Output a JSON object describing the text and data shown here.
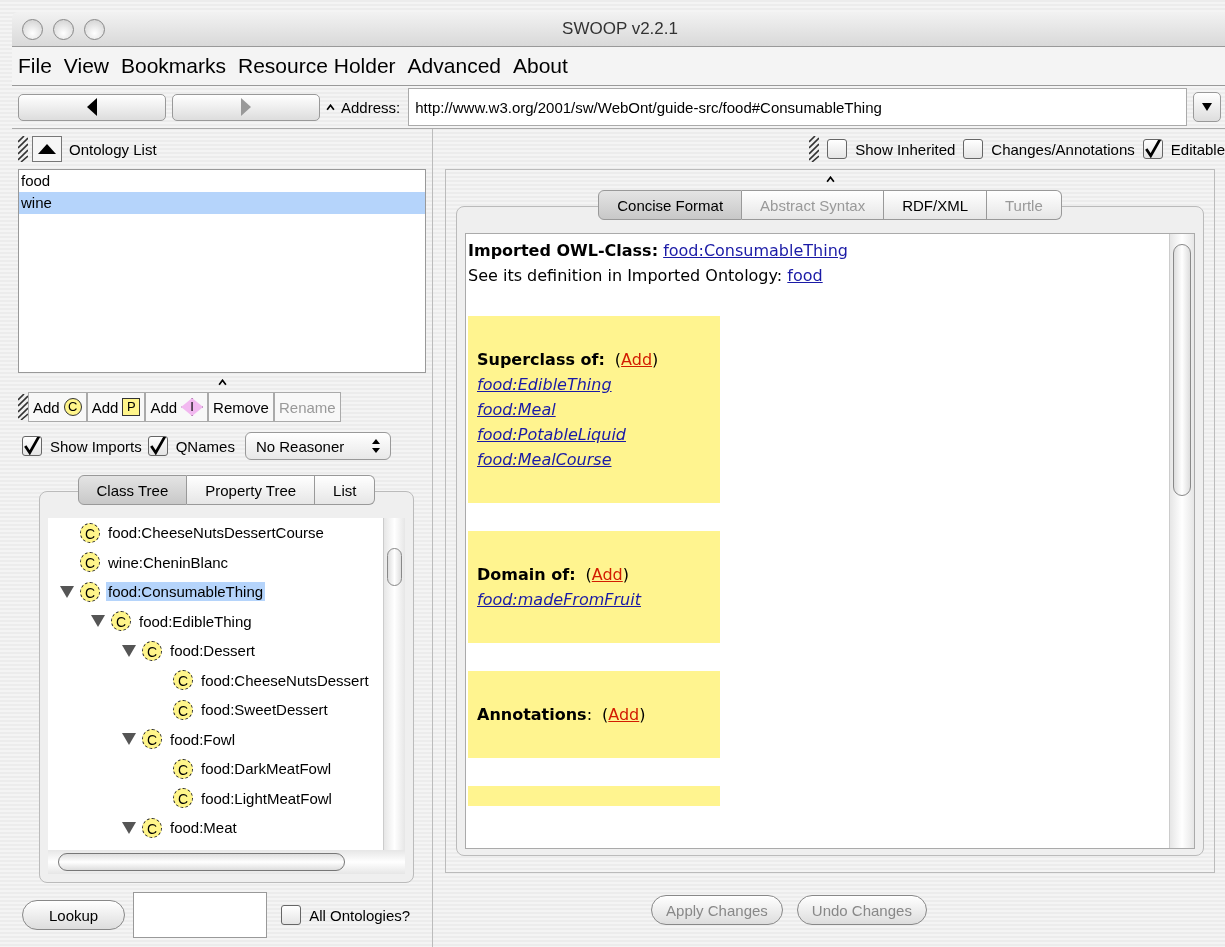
{
  "window": {
    "title": "SWOOP v2.2.1"
  },
  "menu": [
    "File",
    "View",
    "Bookmarks",
    "Resource Holder",
    "Advanced",
    "About"
  ],
  "nav": [
    {
      "kind": "back",
      "disabled": false
    },
    {
      "kind": "forward",
      "disabled": true
    }
  ],
  "address": {
    "label": "Address:",
    "value": "http://www.w3.org/2001/sw/WebOnt/guide-src/food#ConsumableThing"
  },
  "ontology_list": {
    "title": "Ontology List",
    "items": [
      {
        "label": "food",
        "selected": false
      },
      {
        "label": "wine",
        "selected": true
      }
    ]
  },
  "actions": [
    {
      "label": "Add",
      "badge": "C",
      "kind": "class",
      "disabled": false
    },
    {
      "label": "Add",
      "badge": "P",
      "kind": "property",
      "disabled": false
    },
    {
      "label": "Add",
      "badge": "I",
      "kind": "individual",
      "disabled": false
    },
    {
      "label": "Remove",
      "disabled": false
    },
    {
      "label": "Rename",
      "disabled": true
    }
  ],
  "options": [
    {
      "label": "Show Imports",
      "checked": true
    },
    {
      "label": "QNames",
      "checked": true
    }
  ],
  "reasoner": {
    "value": "No Reasoner"
  },
  "tree_tabs": [
    {
      "label": "Class Tree",
      "selected": true
    },
    {
      "label": "Property Tree",
      "selected": false
    },
    {
      "label": "List",
      "selected": false
    }
  ],
  "tree": [
    {
      "label": "food:CheeseNutsDessertCourse",
      "badge": "C",
      "selected": false
    },
    {
      "label": "wine:CheninBlanc",
      "badge": "C",
      "selected": false
    },
    {
      "label": "food:ConsumableThing",
      "badge": "C",
      "selected": true,
      "expanded": true,
      "children": [
        {
          "label": "food:EdibleThing",
          "badge": "C",
          "selected": false,
          "expanded": true,
          "children": [
            {
              "label": "food:Dessert",
              "badge": "C",
              "selected": false,
              "expanded": true,
              "children": [
                {
                  "label": "food:CheeseNutsDessert",
                  "badge": "C",
                  "selected": false
                },
                {
                  "label": "food:SweetDessert",
                  "badge": "C",
                  "selected": false
                }
              ]
            },
            {
              "label": "food:Fowl",
              "badge": "C",
              "selected": false,
              "expanded": true,
              "children": [
                {
                  "label": "food:DarkMeatFowl",
                  "badge": "C",
                  "selected": false
                },
                {
                  "label": "food:LightMeatFowl",
                  "badge": "C",
                  "selected": false
                }
              ]
            },
            {
              "label": "food:Meat",
              "badge": "C",
              "selected": false,
              "expanded": true
            }
          ]
        }
      ]
    }
  ],
  "lookup": {
    "button": "Lookup",
    "option": {
      "label": "All Ontologies?",
      "checked": false
    }
  },
  "view_options": [
    {
      "label": "Show Inherited",
      "checked": false
    },
    {
      "label": "Changes/Annotations",
      "checked": false
    },
    {
      "label": "Editable",
      "checked": true
    }
  ],
  "format_tabs": [
    {
      "label": "Concise Format",
      "selected": true,
      "disabled": false
    },
    {
      "label": "Abstract Syntax",
      "selected": false,
      "disabled": true
    },
    {
      "label": "RDF/XML",
      "selected": false,
      "disabled": false
    },
    {
      "label": "Turtle",
      "selected": false,
      "disabled": true
    }
  ],
  "content": {
    "heading": {
      "label": "Imported OWL-Class:",
      "link": "food:ConsumableThing"
    },
    "note": {
      "text": "See its definition in Imported Ontology:",
      "link": "food"
    },
    "sections": [
      {
        "kind": "section",
        "title": "Superclass of:",
        "open": "(",
        "add": "Add",
        "close": ")",
        "items": [
          "food:EdibleThing",
          "food:Meal",
          "food:PotableLiquid",
          "food:MealCourse"
        ]
      },
      {
        "kind": "section",
        "title": "Domain of:",
        "open": "(",
        "add": "Add",
        "close": ")",
        "items": [
          "food:madeFromFruit"
        ]
      },
      {
        "kind": "section",
        "title": "Annotations",
        "suffix": ":",
        "open": "(",
        "add": "Add",
        "close": ")"
      },
      {
        "kind": "clipped"
      }
    ]
  },
  "bottom_buttons": [
    {
      "label": "Apply Changes",
      "disabled": true
    },
    {
      "label": "Undo Changes",
      "disabled": true
    }
  ]
}
